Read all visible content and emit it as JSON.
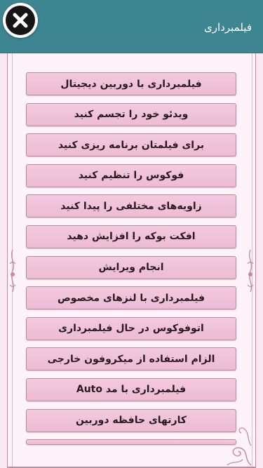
{
  "header": {
    "title": "فیلمبرداری",
    "background_color": "#3d8591",
    "close_icon": "close-icon"
  },
  "menu": {
    "items": [
      {
        "label": "فیلمبرداری با دوربین دیجیتال"
      },
      {
        "label": "ویدئو خود را تجسم کنید"
      },
      {
        "label": "برای فیلمتان برنامه ریزی کنید"
      },
      {
        "label": "فوکوس را تنظیم کنید"
      },
      {
        "label": "زاویه‌های مختلفی را پیدا کنید"
      },
      {
        "label": "افکت بوکه را افزایش دهید"
      },
      {
        "label": "انجام ویرایش"
      },
      {
        "label": "فیلمبرداری با لنزهای مخصوص"
      },
      {
        "label": "اتوفوکوس در حال فیلمبرداری"
      },
      {
        "label": "الزام استفاده از میکروفون خارجی"
      },
      {
        "label": "فیلمبرداری با مد Auto"
      },
      {
        "label": "کارتهای حافظه دوربین"
      }
    ],
    "button_color": "#f0c3d9"
  }
}
